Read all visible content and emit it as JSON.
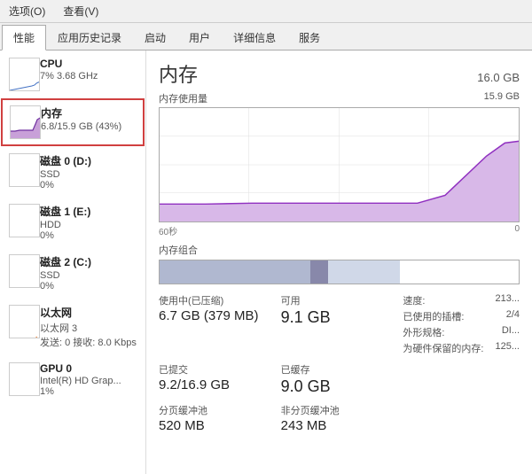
{
  "menu": {
    "items": [
      "选项(O)",
      "查看(V)"
    ]
  },
  "tabs": [
    {
      "label": "性能",
      "active": true
    },
    {
      "label": "应用历史记录"
    },
    {
      "label": "启动"
    },
    {
      "label": "用户"
    },
    {
      "label": "详细信息"
    },
    {
      "label": "服务"
    }
  ],
  "sidebar": {
    "items": [
      {
        "id": "cpu",
        "title": "CPU",
        "line1": "7% 3.68 GHz",
        "selected": false,
        "color": "#4472c4"
      },
      {
        "id": "memory",
        "title": "内存",
        "line1": "6.8/15.9 GB (43%)",
        "selected": true,
        "color": "#7030a0"
      },
      {
        "id": "disk0",
        "title": "磁盘 0 (D:)",
        "line1": "SSD",
        "line2": "0%",
        "selected": false,
        "color": "#70ad47"
      },
      {
        "id": "disk1",
        "title": "磁盘 1 (E:)",
        "line1": "HDD",
        "line2": "0%",
        "selected": false,
        "color": "#70ad47"
      },
      {
        "id": "disk2",
        "title": "磁盘 2 (C:)",
        "line1": "SSD",
        "line2": "0%",
        "selected": false,
        "color": "#70ad47"
      },
      {
        "id": "ethernet",
        "title": "以太网",
        "line1": "以太网 3",
        "line2": "发送: 0 接收: 8.0 Kbps",
        "selected": false,
        "color": "#ed7d31"
      },
      {
        "id": "gpu",
        "title": "GPU 0",
        "line1": "Intel(R) HD Grap...",
        "line2": "1%",
        "selected": false,
        "color": "#4472c4"
      }
    ]
  },
  "content": {
    "title": "内存",
    "total": "16.0 GB",
    "chart": {
      "top_label": "内存使用量",
      "top_value": "15.9 GB",
      "time_start": "60秒",
      "time_end": "0"
    },
    "composition": {
      "label": "内存组合",
      "used_pct": 42,
      "modified_pct": 5,
      "standby_pct": 20,
      "free_pct": 33
    },
    "stats": {
      "in_use_label": "使用中(已压缩)",
      "in_use_value": "6.7 GB (379 MB)",
      "available_label": "可用",
      "available_value": "9.1 GB",
      "speed_label": "速度:",
      "speed_value": "213...",
      "committed_label": "已提交",
      "committed_value": "9.2/16.9 GB",
      "cached_label": "已缓存",
      "cached_value": "9.0 GB",
      "slots_label": "已使用的插槽:",
      "slots_value": "2/4",
      "form_label": "外形规格:",
      "form_value": "DI...",
      "reserved_label": "为硬件保留的内存:",
      "reserved_value": "125...",
      "paged_pool_label": "分页缓冲池",
      "paged_pool_value": "520 MB",
      "nonpaged_pool_label": "非分页缓冲池",
      "nonpaged_pool_value": "243 MB"
    }
  }
}
